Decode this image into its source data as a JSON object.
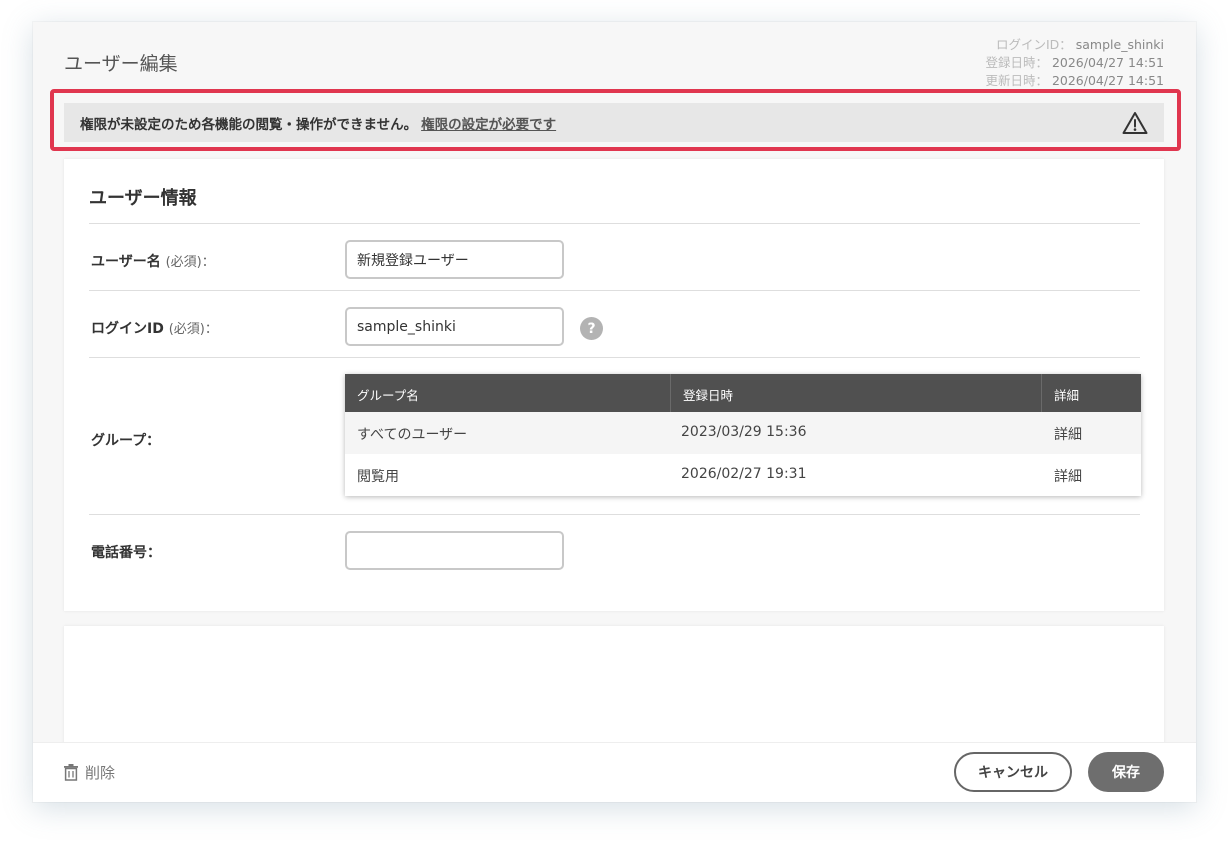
{
  "page": {
    "title": "ユーザー編集"
  },
  "meta": {
    "login_id_label": "ログインID：",
    "login_id": "sample_shinki",
    "created_label": "登録日時：",
    "created": "2026/04/27 14:51",
    "updated_label": "更新日時：",
    "updated": "2026/04/27 14:51"
  },
  "alert": {
    "message": "権限が未設定のため各機能の閲覧・操作ができません。",
    "link": "権限の設定が必要です",
    "icon": "warning-triangle-icon",
    "highlight_color": "#e0364f"
  },
  "user_info": {
    "title": "ユーザー情報",
    "username_label": "ユーザー名",
    "username_required": "(必須)：",
    "username_value": "新規登録ユーザー",
    "login_id_label": "ログインID",
    "login_id_required": "(必須)：",
    "login_id_value": "sample_shinki",
    "help": "?",
    "group_label": "グループ：",
    "group_table": {
      "columns": [
        "グループ名",
        "登録日時",
        "詳細"
      ],
      "rows": [
        {
          "name": "すべてのユーザー",
          "date": "2023/03/29 15:36",
          "detail": "詳細"
        },
        {
          "name": "閲覧用",
          "date": "2026/02/27 19:31",
          "detail": "詳細"
        }
      ]
    },
    "phone_label": "電話番号：",
    "phone_value": ""
  },
  "footer": {
    "delete": "削除",
    "cancel": "キャンセル",
    "save": "保存"
  }
}
